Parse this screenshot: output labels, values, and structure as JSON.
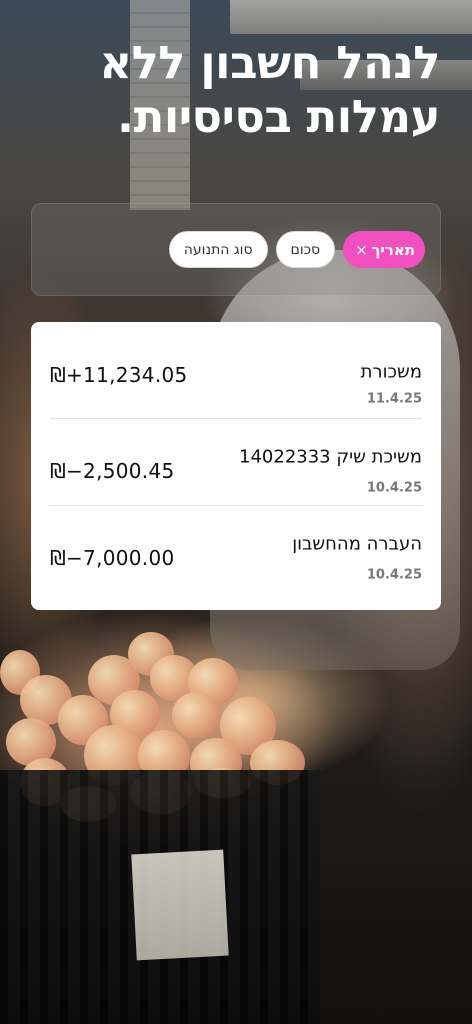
{
  "headline": "לנהל חשבון ללא עמלות בסיסיות.",
  "filters": {
    "type_label": "סוג התנועה",
    "amount_label": "סכום",
    "date_label": "תאריך",
    "clear_symbol": "×"
  },
  "transactions": [
    {
      "title": "משכורת",
      "date": "11.4.25",
      "amount": "₪+11,234.05"
    },
    {
      "title": "משיכת שיק 14022333",
      "date": "10.4.25",
      "amount": "₪−2,500.45"
    },
    {
      "title": "העברה מהחשבון",
      "date": "10.4.25",
      "amount": "₪−7,000.00"
    }
  ],
  "colors": {
    "accent": "#f24fc0",
    "card": "#ffffff",
    "headline": "#ffffff"
  }
}
